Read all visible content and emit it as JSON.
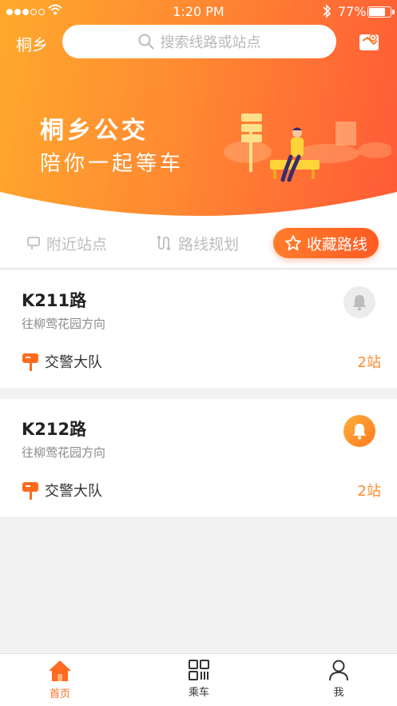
{
  "status_bar": {
    "time": "1:20 PM",
    "battery": "77%"
  },
  "header": {
    "city": "桐乡",
    "search_placeholder": "搜索线路或站点"
  },
  "banner": {
    "title": "桐乡公交",
    "subtitle": "陪你一起等车"
  },
  "tabs": [
    {
      "label": "附近站点",
      "icon": "stop-sign-icon"
    },
    {
      "label": "路线规划",
      "icon": "route-icon"
    },
    {
      "label": "收藏路线",
      "icon": "star-icon",
      "active": true
    }
  ],
  "favorites": [
    {
      "route": "K211路",
      "direction": "往柳莺花园方向",
      "stop": "交警大队",
      "distance": "2站",
      "reminder_on": false
    },
    {
      "route": "K212路",
      "direction": "往柳莺花园方向",
      "stop": "交警大队",
      "distance": "2站",
      "reminder_on": true
    }
  ],
  "tabbar": [
    {
      "label": "首页",
      "icon": "home-icon",
      "active": true
    },
    {
      "label": "乘车",
      "icon": "qr-code-icon"
    },
    {
      "label": "我",
      "icon": "user-icon"
    }
  ],
  "colors": {
    "accent": "#ff6a1e",
    "gradient_start": "#ffa92c",
    "gradient_end": "#ff5a36",
    "inactive_bell": "#ececec"
  }
}
